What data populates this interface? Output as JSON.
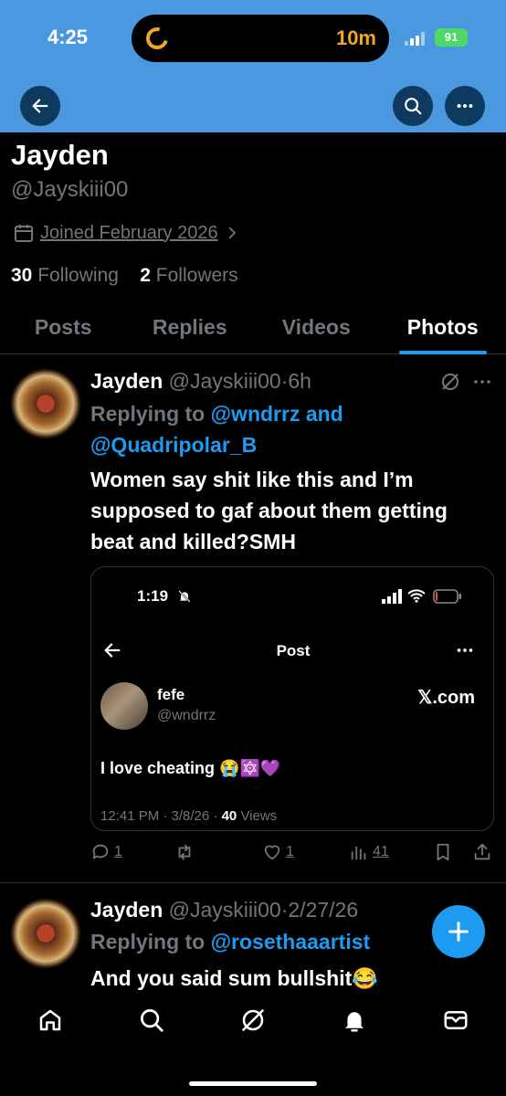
{
  "status": {
    "time": "4:25",
    "timer": "10m",
    "battery": "91"
  },
  "profile": {
    "name": "Jayden",
    "handle": "@Jayskiii00",
    "joined": "Joined February 2026",
    "following_count": "30",
    "following_label": "Following",
    "followers_count": "2",
    "followers_label": "Followers"
  },
  "tabs": [
    {
      "label": "Posts"
    },
    {
      "label": "Replies"
    },
    {
      "label": "Videos"
    },
    {
      "label": "Photos",
      "active": true
    }
  ],
  "tweets": [
    {
      "name": "Jayden",
      "handle": "@Jayskiii00",
      "time": "6h",
      "replying_prefix": "Replying to",
      "replying_to_1": "@wndrrz",
      "replying_and": "and",
      "replying_to_2": "@Quadripolar_B",
      "text_line1": "Women say shit like this and I’m",
      "text_line2": "supposed to gaf about them getting",
      "text_line3": "beat and killed?SMH",
      "embed": {
        "time": "1:19",
        "title": "Post",
        "name": "fefe",
        "handle": "@wndrrz",
        "source": "𝕏.com",
        "body": "I love cheating 😭🔯💜",
        "meta_prefix": "12:41 PM · 3/8/26 · ",
        "views_count": "40",
        "views_label": "Views"
      },
      "replies": "1",
      "likes": "1",
      "views": "41"
    },
    {
      "name": "Jayden",
      "handle": "@Jayskiii00",
      "time": "2/27/26",
      "replying_prefix": "Replying to",
      "replying_to_1": "@rosethaaartist",
      "text_line1": "And you said sum bullshit😂"
    }
  ],
  "icons": {
    "back": "arrow-left-icon",
    "search": "search-icon",
    "more": "more-icon",
    "grok": "grok-icon",
    "calendar": "calendar-icon",
    "compose": "plus-icon"
  },
  "colors": {
    "header": "#4a98e0",
    "accent": "#1d9bf0",
    "muted": "#71767b"
  }
}
